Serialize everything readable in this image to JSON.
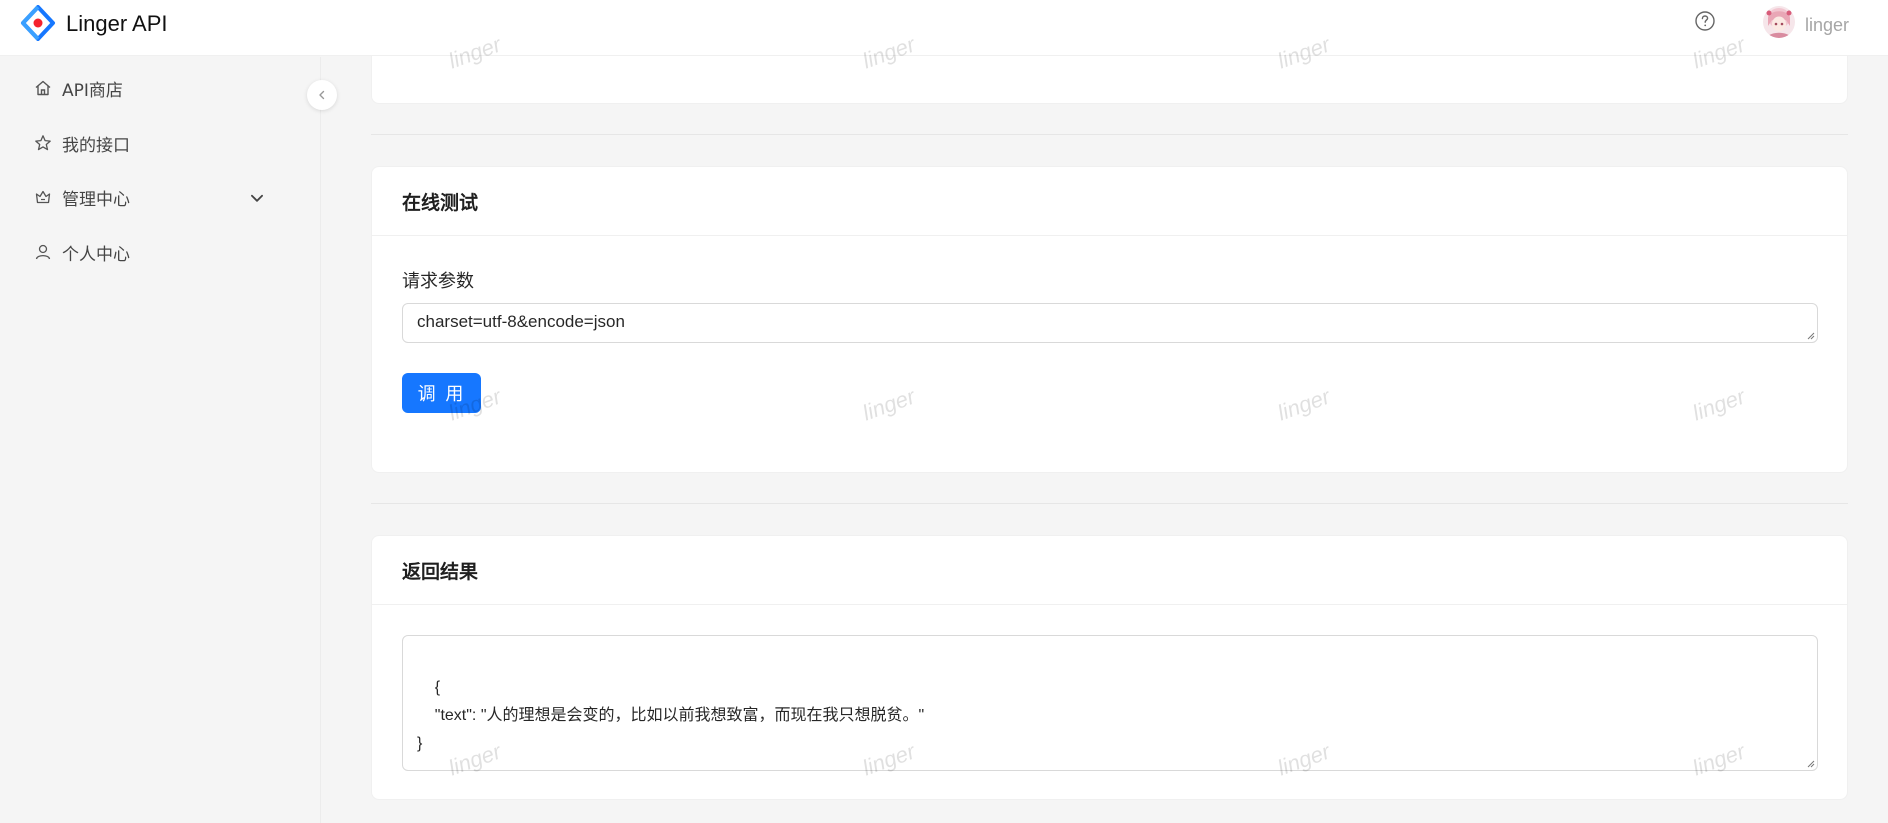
{
  "app": {
    "title": "Linger API"
  },
  "header": {
    "username": "linger"
  },
  "sidebar": {
    "items": [
      {
        "label": "API商店",
        "icon": "home-icon"
      },
      {
        "label": "我的接口",
        "icon": "star-icon"
      },
      {
        "label": "管理中心",
        "icon": "crown-icon",
        "expandable": true
      },
      {
        "label": "个人中心",
        "icon": "user-icon"
      }
    ]
  },
  "test_card": {
    "title": "在线测试",
    "param_label": "请求参数",
    "param_value": "charset=utf-8&encode=json",
    "invoke_label": "调 用"
  },
  "result_card": {
    "title": "返回结果",
    "result_text": "{\n    \"text\": \"人的理想是会变的，比如以前我想致富，而现在我只想脱贫。\"\n}"
  },
  "watermark": {
    "text": "linger"
  },
  "colors": {
    "primary": "#1677ff",
    "background": "#f5f5f5",
    "card": "#ffffff"
  }
}
